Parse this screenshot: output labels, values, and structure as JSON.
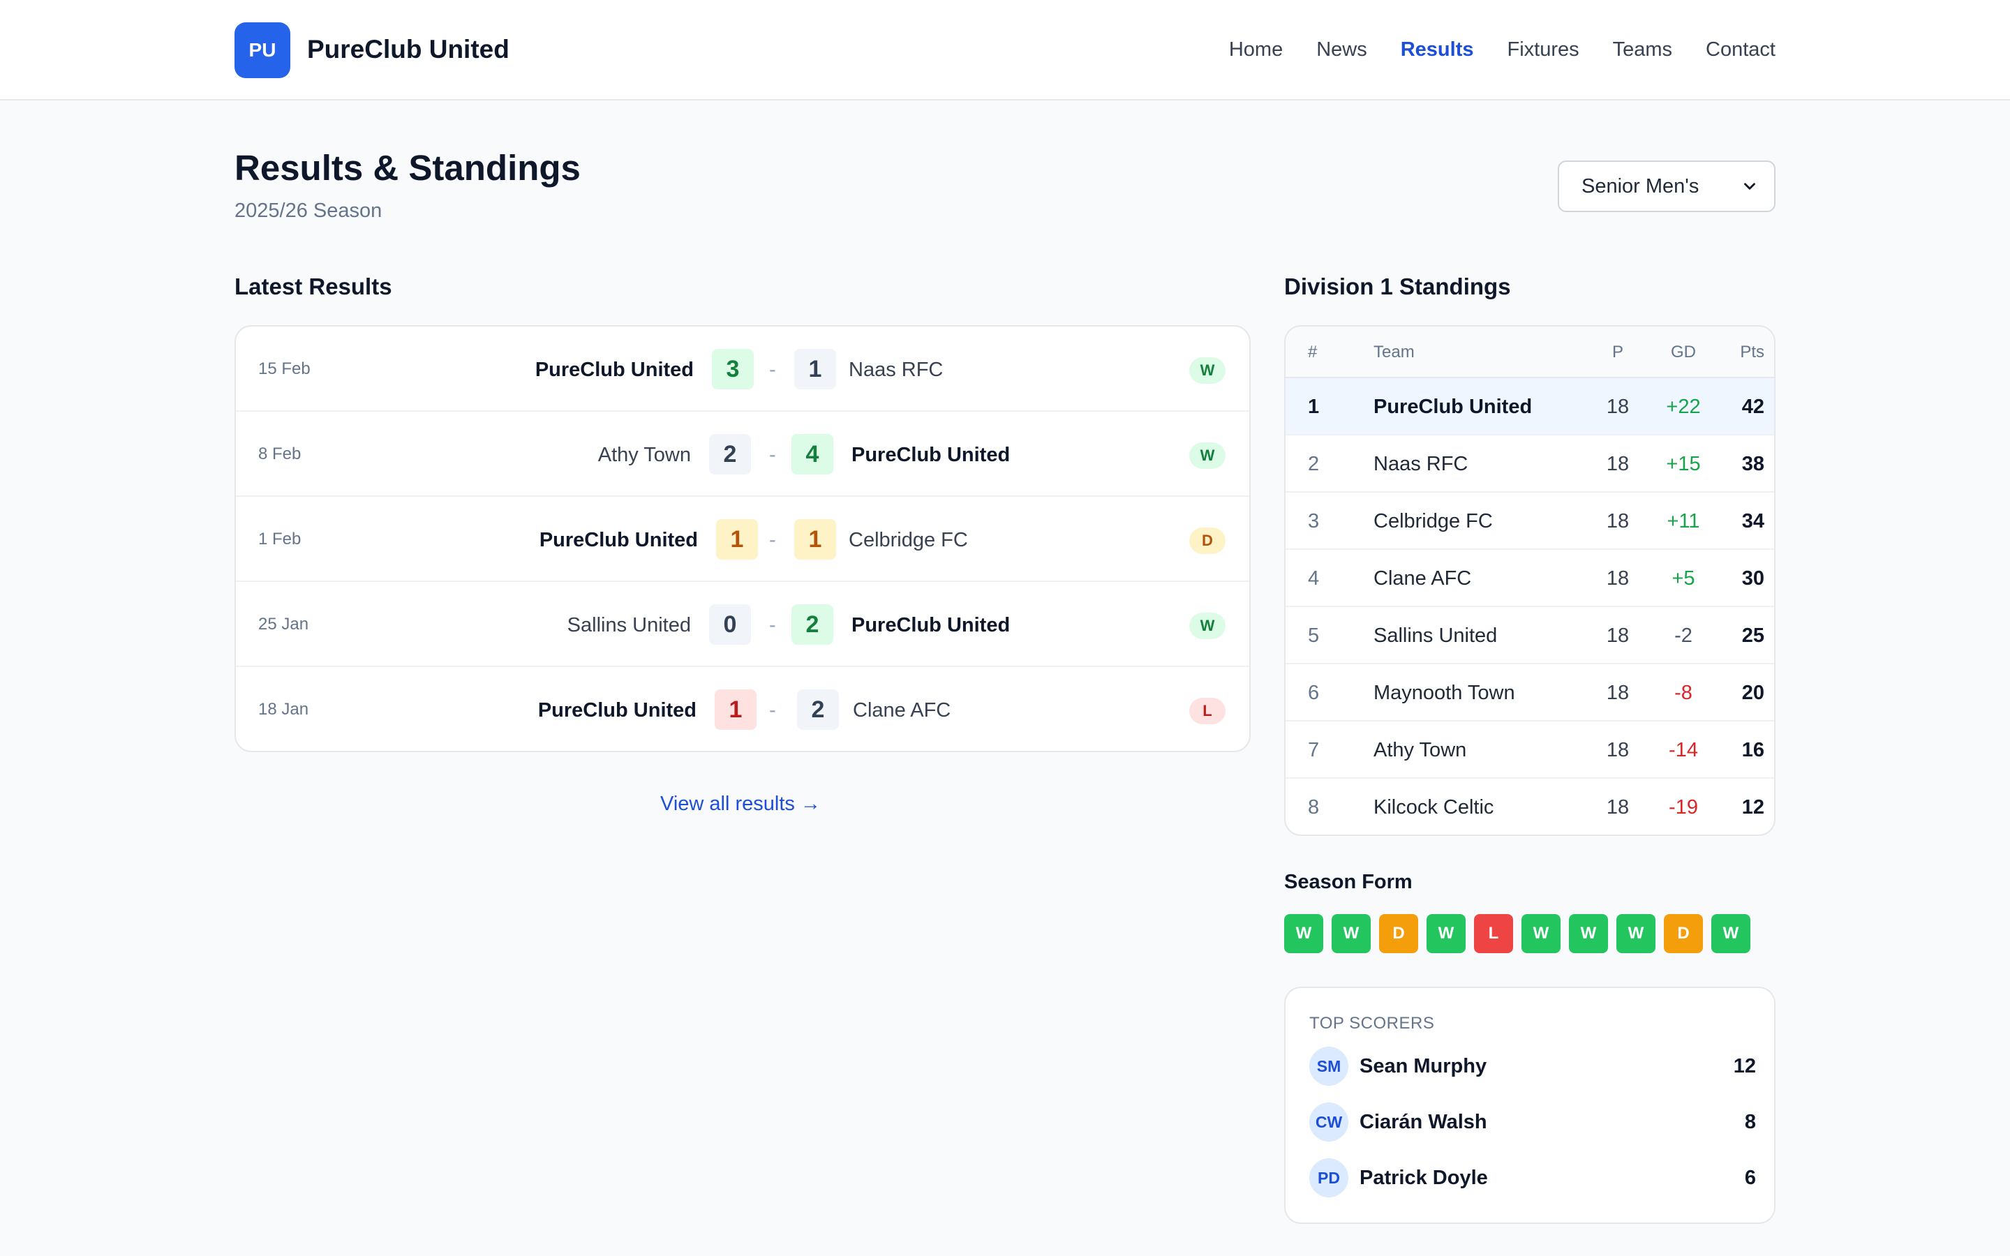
{
  "header": {
    "logo_initials": "PU",
    "brand": "PureClub United",
    "nav": [
      "Home",
      "News",
      "Results",
      "Fixtures",
      "Teams",
      "Contact"
    ],
    "active_nav": "Results"
  },
  "page": {
    "title": "Results & Standings",
    "subtitle": "2025/26 Season",
    "team_select": "Senior Men's"
  },
  "results": {
    "title": "Latest Results",
    "view_all": "View all results →",
    "rows": [
      {
        "date": "15 Feb",
        "home": "PureClub United",
        "home_score": "3",
        "away_score": "1",
        "away": "Naas RFC",
        "result": "W"
      },
      {
        "date": "8 Feb",
        "home": "Athy Town",
        "home_score": "2",
        "away_score": "4",
        "away": "PureClub United",
        "result": "W"
      },
      {
        "date": "1 Feb",
        "home": "PureClub United",
        "home_score": "1",
        "away_score": "1",
        "away": "Celbridge FC",
        "result": "D"
      },
      {
        "date": "25 Jan",
        "home": "Sallins United",
        "home_score": "0",
        "away_score": "2",
        "away": "PureClub United",
        "result": "W"
      },
      {
        "date": "18 Jan",
        "home": "PureClub United",
        "home_score": "1",
        "away_score": "2",
        "away": "Clane AFC",
        "result": "L"
      }
    ],
    "dash": "-"
  },
  "standings": {
    "title": "Division 1 Standings",
    "headers": {
      "pos": "#",
      "team": "Team",
      "p": "P",
      "gd": "GD",
      "pts": "Pts"
    },
    "rows": [
      {
        "pos": "1",
        "team": "PureClub United",
        "p": "18",
        "gd": "+22",
        "pts": "42"
      },
      {
        "pos": "2",
        "team": "Naas RFC",
        "p": "18",
        "gd": "+15",
        "pts": "38"
      },
      {
        "pos": "3",
        "team": "Celbridge FC",
        "p": "18",
        "gd": "+11",
        "pts": "34"
      },
      {
        "pos": "4",
        "team": "Clane AFC",
        "p": "18",
        "gd": "+5",
        "pts": "30"
      },
      {
        "pos": "5",
        "team": "Sallins United",
        "p": "18",
        "gd": "-2",
        "pts": "25"
      },
      {
        "pos": "6",
        "team": "Maynooth Town",
        "p": "18",
        "gd": "-8",
        "pts": "20"
      },
      {
        "pos": "7",
        "team": "Athy Town",
        "p": "18",
        "gd": "-14",
        "pts": "16"
      },
      {
        "pos": "8",
        "team": "Kilcock Celtic",
        "p": "18",
        "gd": "-19",
        "pts": "12"
      }
    ]
  },
  "form": {
    "title": "Season Form",
    "results": [
      "W",
      "W",
      "D",
      "W",
      "L",
      "W",
      "W",
      "W",
      "D",
      "W"
    ]
  },
  "scorers": {
    "title": "TOP SCORERS",
    "rows": [
      {
        "initials": "SM",
        "name": "Sean Murphy",
        "goals": "12"
      },
      {
        "initials": "CW",
        "name": "Ciarán Walsh",
        "goals": "8"
      },
      {
        "initials": "PD",
        "name": "Patrick Doyle",
        "goals": "6"
      }
    ]
  },
  "colors": {
    "accent": "#2563eb",
    "win": "#22c55e",
    "draw": "#f59e0b",
    "loss": "#ef4444"
  }
}
